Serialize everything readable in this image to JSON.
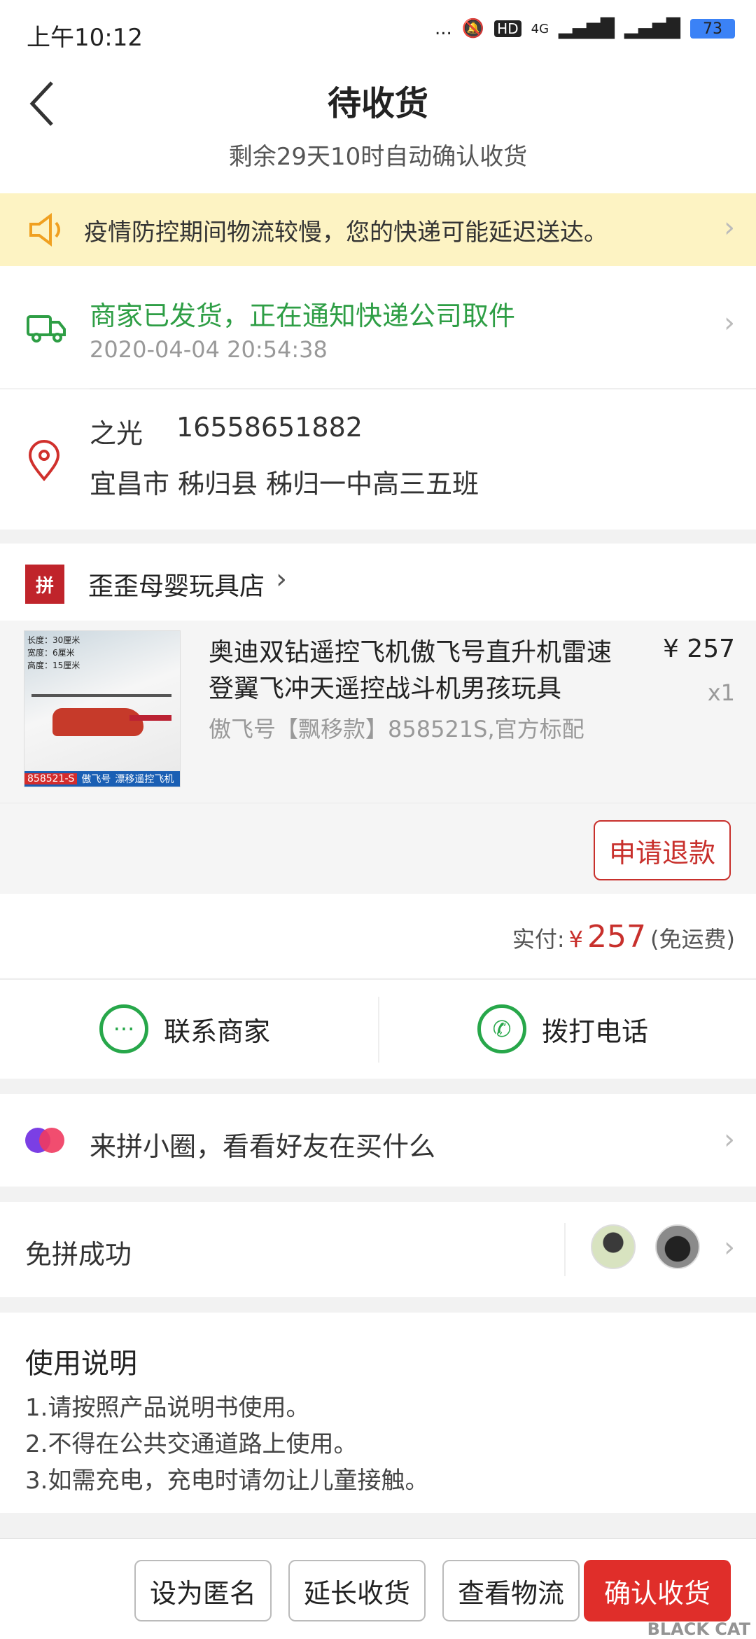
{
  "status_bar": {
    "time": "上午10:12",
    "dots": "...",
    "hd": "HD",
    "network": "4G",
    "battery": "73"
  },
  "header": {
    "title": "待收货",
    "subtitle": "剩余29天10时自动确认收货"
  },
  "notice": {
    "text": "疫情防控期间物流较慢，您的快递可能延迟送达。"
  },
  "logistics": {
    "status": "商家已发货，正在通知快递公司取件",
    "time": "2020-04-04 20:54:38"
  },
  "address": {
    "name": "之光",
    "phone": "16558651882",
    "line": "宜昌市 秭归县 秭归一中高三五班"
  },
  "store": {
    "logo_text": "拼",
    "name": "歪歪母婴玩具店",
    "product": {
      "title": "奥迪双钻遥控飞机傲飞号直升机雷速登翼飞冲天遥控战斗机男孩玩具",
      "price": "¥ 257",
      "qty": "x1",
      "spec": "傲飞号【飘移款】858521S,官方标配",
      "image_caption_model": "858521-S",
      "image_caption_name": "傲飞号",
      "image_caption_type": "漂移遥控飞机",
      "image_spec_length": "长度：30厘米",
      "image_spec_width": "宽度：6厘米",
      "image_spec_height": "高度：15厘米"
    },
    "refund_label": "申请退款"
  },
  "payment": {
    "label": "实付:",
    "currency": "¥",
    "amount": "257",
    "note": "(免运费)"
  },
  "contact": {
    "merchant_label": "联系商家",
    "call_label": "拨打电话"
  },
  "promo": {
    "text": "来拼小圈，看看好友在买什么"
  },
  "group": {
    "text": "免拼成功"
  },
  "usage": {
    "title": "使用说明",
    "lines": [
      "1.请按照产品说明书使用。",
      "2.不得在公共交通道路上使用。",
      "3.如需充电，充电时请勿让儿童接触。"
    ]
  },
  "bottom_bar": {
    "anonymous_label": "设为匿名",
    "extend_label": "延长收货",
    "logistics_label": "查看物流",
    "confirm_label": "确认收货"
  },
  "watermark": {
    "text": "BLACK CAT"
  },
  "colors": {
    "accent_red": "#e02e2a",
    "success_green": "#2e9e45",
    "notice_bg": "#fdf3c3"
  },
  "icons": [
    "back-arrow",
    "mute-bell",
    "signal",
    "battery",
    "speaker",
    "truck",
    "location-pin",
    "chevron-right",
    "chat-bubble",
    "phone"
  ]
}
